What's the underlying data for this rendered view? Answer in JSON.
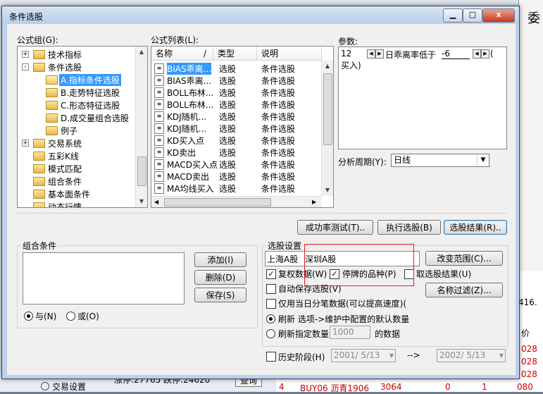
{
  "dialog": {
    "title": "条件选股",
    "close_label": "x"
  },
  "formula_group": {
    "label": "公式组(G):",
    "tree": [
      {
        "label": "技术指标",
        "level": 0,
        "expander": "+"
      },
      {
        "label": "条件选股",
        "level": 0,
        "expander": "-"
      },
      {
        "label": "A.指标条件选股",
        "level": 1,
        "selected": true
      },
      {
        "label": "B.走势特征选股",
        "level": 1
      },
      {
        "label": "C.形态特征选股",
        "level": 1
      },
      {
        "label": "D.成交量组合选股",
        "level": 1
      },
      {
        "label": "例子",
        "level": 1
      },
      {
        "label": "交易系统",
        "level": 0,
        "expander": "+"
      },
      {
        "label": "五彩K线",
        "level": 0
      },
      {
        "label": "模式匹配",
        "level": 0
      },
      {
        "label": "组合条件",
        "level": 0
      },
      {
        "label": "基本面条件",
        "level": 0
      },
      {
        "label": "动态行情",
        "level": 0
      }
    ]
  },
  "formula_list": {
    "label": "公式列表(L):",
    "columns": [
      "名称",
      "/",
      "类型",
      "说明"
    ],
    "rows": [
      {
        "name": "BIAS乖离...",
        "type": "选股",
        "desc": "条件选股",
        "selected": true
      },
      {
        "name": "BIAS乖离...",
        "type": "选股",
        "desc": "条件选股"
      },
      {
        "name": "BOLL布林...",
        "type": "选股",
        "desc": "条件选股"
      },
      {
        "name": "BOLL布林...",
        "type": "选股",
        "desc": "条件选股"
      },
      {
        "name": "KDJ随机...",
        "type": "选股",
        "desc": "条件选股"
      },
      {
        "name": "KDJ随机...",
        "type": "选股",
        "desc": "条件选股"
      },
      {
        "name": "KD买入点",
        "type": "选股",
        "desc": "条件选股"
      },
      {
        "name": "KD卖出",
        "type": "选股",
        "desc": "条件选股"
      },
      {
        "name": "MACD买入点",
        "type": "选股",
        "desc": "条件选股"
      },
      {
        "name": "MACD卖出",
        "type": "选股",
        "desc": "条件选股"
      },
      {
        "name": "MA均线买入",
        "type": "选股",
        "desc": "条件选股"
      }
    ]
  },
  "params": {
    "label": "参数:",
    "line1_value": "12",
    "line1_text": "日乖离率低于",
    "line1_value2": "-6",
    "line1_tail": "(",
    "line2_text": "买入)"
  },
  "period": {
    "label": "分析周期(Y):",
    "value": "日线"
  },
  "buttons": {
    "success_test": "成功率测试(T)..",
    "execute": "执行选股(B)",
    "result": "选股结果(R)..",
    "add": "添加(I)",
    "delete": "删除(D)",
    "save": "保存(S)",
    "change_range": "改变范围(C)...",
    "name_filter": "名称过滤(Z)..."
  },
  "combo": {
    "label": "组合条件",
    "and_label": "与(N)",
    "or_label": "或(O)"
  },
  "settings": {
    "label": "选股设置",
    "range_text1": "上海A股",
    "range_text2": "深圳A股",
    "restore_data": "复权数据(W)",
    "suspended": "停牌的品种(P)",
    "pick_result": "取选股结果(U)",
    "auto_save": "自动保存选股(V)",
    "today_only": "仅用当日分笔数据(可以提高速度)(",
    "refresh_opt": "刷新 选项->维护中配置的默认数量",
    "refresh_count": "刷新指定数量(F)",
    "count_value": "1000",
    "count_suffix": "的数据",
    "history": "历史阶段(H)",
    "date_from": "2001/ 5/13",
    "arrow": "-->",
    "date_to": "2002/ 5/13"
  },
  "background": {
    "corner_char": "委",
    "status_text": "涨停:27765 跌停:24620",
    "status_btn": "查询",
    "sidebar_item": "交易设置",
    "right_vals": [
      "416.",
      "价",
      "028",
      "028",
      "028",
      "080"
    ],
    "row1": [
      "4",
      "BUY06 沥青1906",
      "3064",
      "0",
      "1"
    ]
  }
}
